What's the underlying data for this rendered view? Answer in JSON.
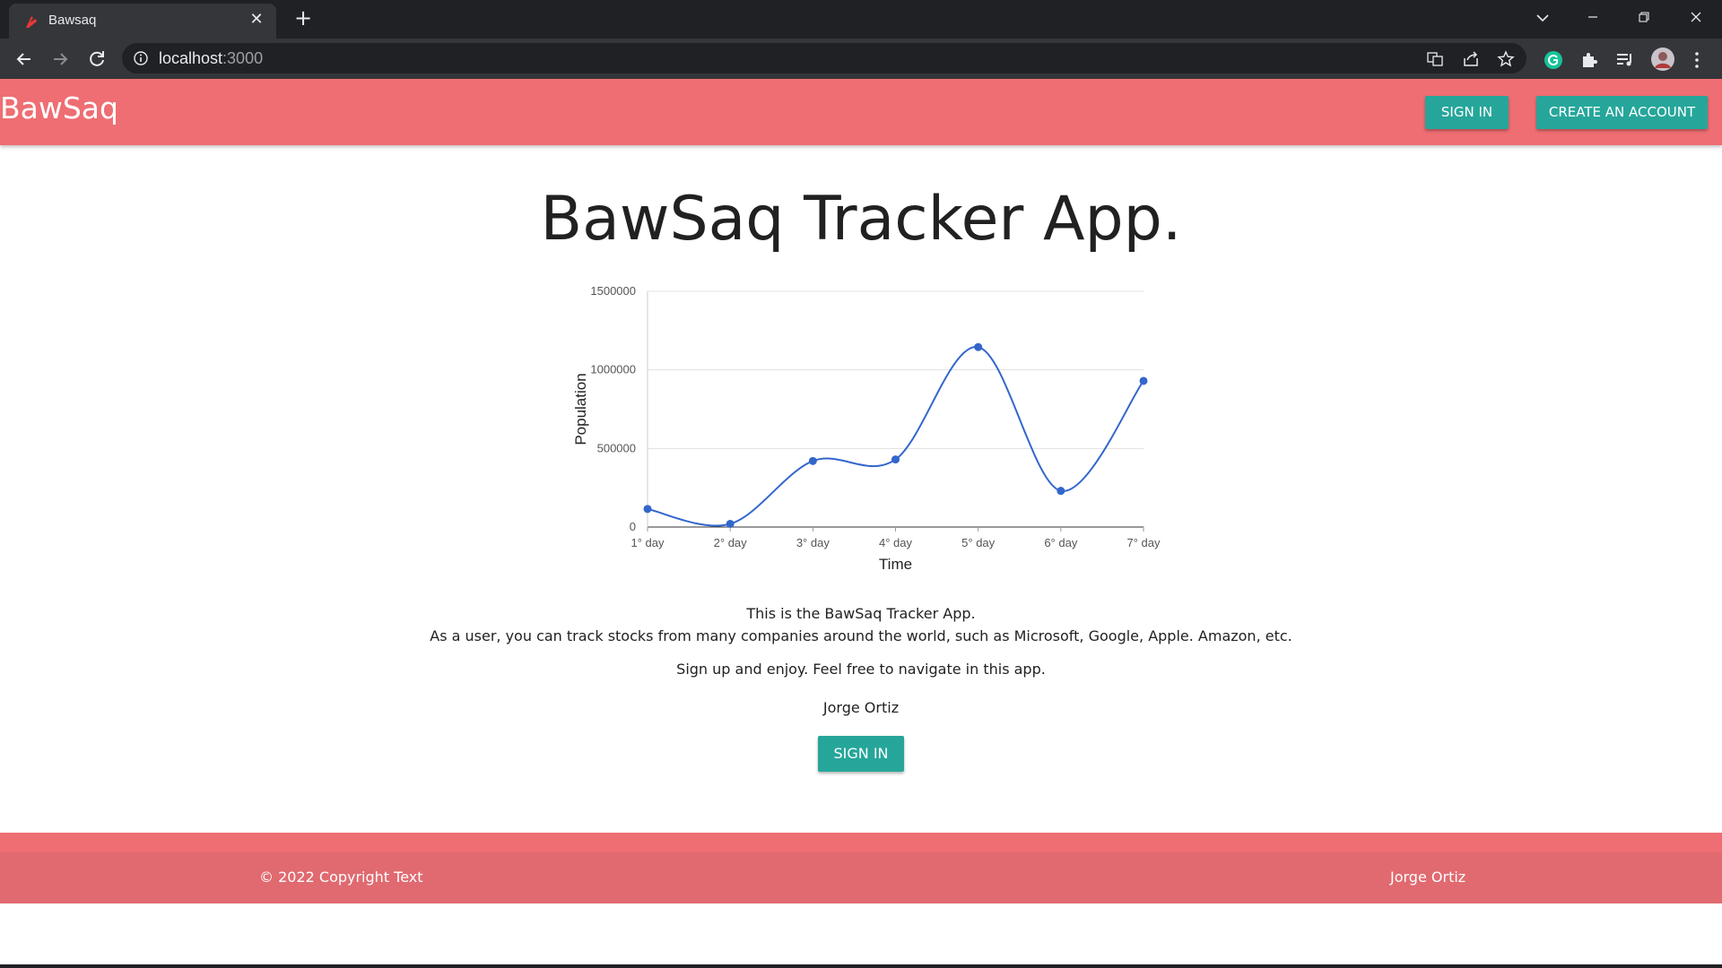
{
  "browser": {
    "tab_title": "Bawsaq",
    "close_glyph": "✕",
    "new_tab_glyph": "+",
    "url_host": "localhost",
    "url_port": ":3000"
  },
  "navbar": {
    "brand": "BawSaq",
    "sign_in": "SIGN IN",
    "create_account": "CREATE AN ACCOUNT",
    "color": "#ee6e73",
    "button_color": "#26a69a"
  },
  "main": {
    "title": "BawSaq Tracker App.",
    "intro_line1": "This is the BawSaq Tracker App.",
    "intro_line2": "As a user, you can track stocks from many companies around the world, such as Microsoft, Google, Apple. Amazon, etc.",
    "signup_text": "Sign up and enjoy. Feel free to navigate in this app.",
    "author": "Jorge Ortiz",
    "sign_in": "SIGN IN"
  },
  "chart_data": {
    "type": "line",
    "categories": [
      "1° day",
      "2° day",
      "3° day",
      "4° day",
      "5° day",
      "6° day",
      "7° day"
    ],
    "series": [
      {
        "values": [
          115000,
          20000,
          420000,
          430000,
          1145000,
          230000,
          930000
        ]
      }
    ],
    "xlabel": "Time",
    "ylabel": "Population",
    "yticks": [
      "0",
      "500000",
      "1000000",
      "1500000"
    ],
    "ylim": [
      0,
      1500000
    ],
    "line_color": "#3366cc",
    "grid": true,
    "smooth": true
  },
  "footer": {
    "copyright": "© 2022 Copyright Text",
    "author": "Jorge Ortiz"
  }
}
